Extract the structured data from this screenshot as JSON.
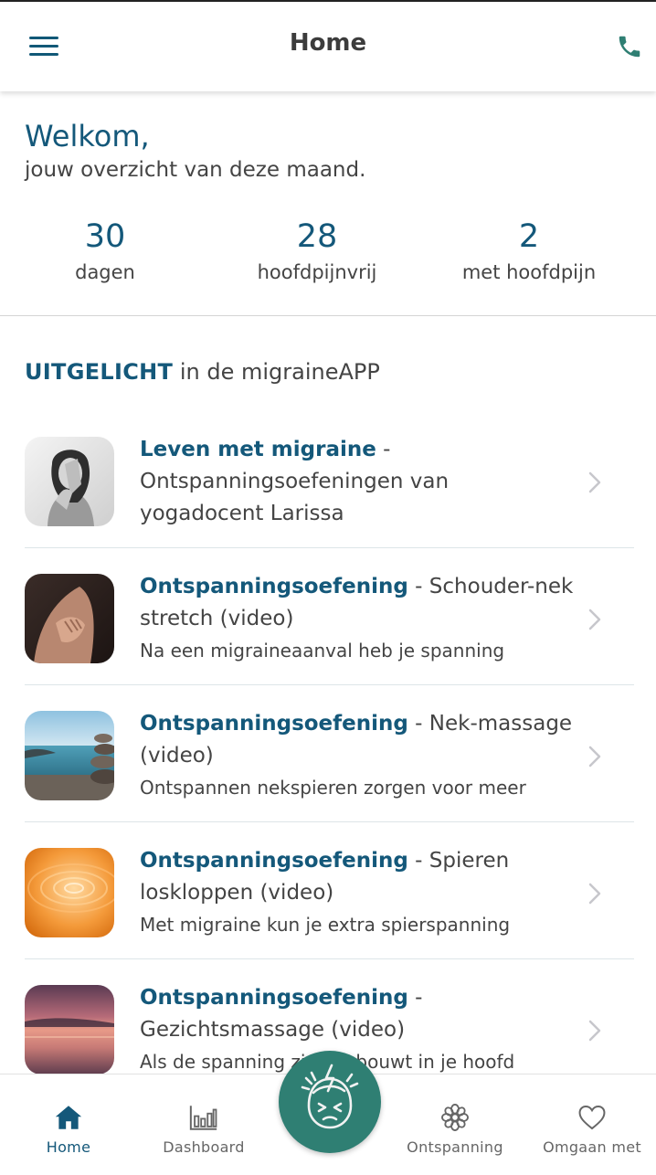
{
  "header": {
    "title": "Home"
  },
  "welcome": {
    "title": "Welkom,",
    "subtitle": "jouw overzicht van deze maand.",
    "stats": [
      {
        "value": "30",
        "label": "dagen"
      },
      {
        "value": "28",
        "label": "hoofdpijnvrij"
      },
      {
        "value": "2",
        "label": "met hoofdpijn"
      }
    ]
  },
  "featured": {
    "heading_bold": "UITGELICHT",
    "heading_rest": "in de migraineAPP",
    "items": [
      {
        "title": "Leven met migraine",
        "sep": "-",
        "rest": "Ontspanningsoefeningen van yogadocent Larissa",
        "desc": ""
      },
      {
        "title": "Ontspanningsoefening",
        "sep": "-",
        "rest": "Schouder-nek stretch (video)",
        "desc": "Na een migraineaanval heb je spanning"
      },
      {
        "title": "Ontspanningsoefening",
        "sep": "-",
        "rest": "Nek-massage (video)",
        "desc": "Ontspannen nekspieren zorgen voor meer"
      },
      {
        "title": "Ontspanningsoefening",
        "sep": "-",
        "rest": "Spieren loskloppen (video)",
        "desc": "Met migraine kun je extra spierspanning"
      },
      {
        "title": "Ontspanningsoefening",
        "sep": "-",
        "rest": "Gezichtsmassage (video)",
        "desc": "Als de spanning zich opbouwt in je hoofd"
      }
    ]
  },
  "nav": {
    "items": [
      {
        "label": "Home",
        "icon": "home-icon"
      },
      {
        "label": "Dashboard",
        "icon": "bar-chart-icon"
      },
      {
        "label": "Ontspanning",
        "icon": "flower-icon"
      },
      {
        "label": "Omgaan met",
        "icon": "heart-icon"
      }
    ],
    "fab_icon": "headache-face-icon"
  },
  "colors": {
    "primary": "#14587a",
    "accent": "#2f7f73",
    "text": "#444444"
  }
}
